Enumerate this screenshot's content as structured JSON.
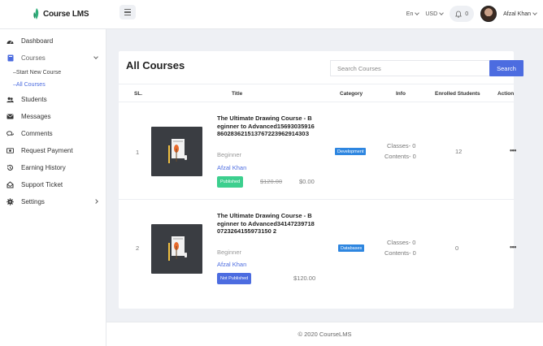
{
  "app": {
    "logo_text": "Course LMS"
  },
  "topbar": {
    "language": "En",
    "currency": "USD",
    "notification_count": "0",
    "user_name": "Afzal Khan"
  },
  "sidebar": {
    "items": [
      {
        "label": "Dashboard",
        "icon": "dashboard-icon"
      },
      {
        "label": "Courses",
        "icon": "book-icon"
      },
      {
        "label": "Students",
        "icon": "users-icon"
      },
      {
        "label": "Messages",
        "icon": "envelope-icon"
      },
      {
        "label": "Comments",
        "icon": "comments-icon"
      },
      {
        "label": "Request Payment",
        "icon": "money-icon"
      },
      {
        "label": "Earning History",
        "icon": "history-icon"
      },
      {
        "label": "Support Ticket",
        "icon": "ticket-icon"
      },
      {
        "label": "Settings",
        "icon": "gear-icon"
      }
    ],
    "courses_sub": [
      {
        "label": "Start New Course"
      },
      {
        "label": "All Courses"
      }
    ]
  },
  "main": {
    "title": "All Courses",
    "search_placeholder": "Search Courses",
    "search_button": "Search",
    "columns": [
      "SL.",
      "Title",
      "Category",
      "Info",
      "Enrolled Students",
      "Action"
    ],
    "rows": [
      {
        "sl": "1",
        "title": "The Ultimate Drawing Course - Beginner to Advanced1569303591686028362151376722396291430З",
        "level": "Beginner",
        "author": "Afzal Khan",
        "status": "Published",
        "old_price": "$120.00",
        "price": "$0.00",
        "category": "Development",
        "classes": "Classes- 0",
        "contents": "Contents- 0",
        "enrolled": "12",
        "action": "•••"
      },
      {
        "sl": "2",
        "title": "The Ultimate Drawing Course - Beginner to Advanced341472397180723264155973150 2",
        "level": "Beginner",
        "author": "Afzal Khan",
        "status": "Not Published",
        "old_price": "",
        "price": "$120.00",
        "category": "Databases",
        "classes": "Classes- 0",
        "contents": "Contents- 0",
        "enrolled": "0",
        "action": "•••"
      }
    ]
  },
  "footer": {
    "text": "© 2020 CourseLMS"
  },
  "colors": {
    "accent": "#4c6ce0",
    "published": "#3ccf8e",
    "category": "#2e86e0"
  }
}
